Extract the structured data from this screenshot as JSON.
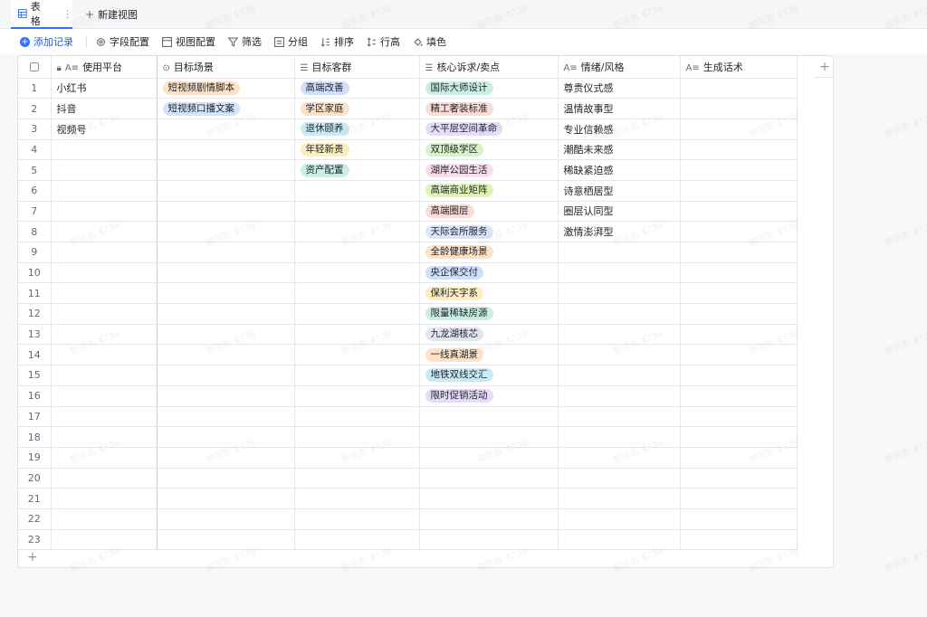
{
  "tabs": [
    {
      "label": "表格",
      "icon": "table-icon",
      "more": "⋮"
    },
    {
      "label": "新建视图",
      "icon": "plus-icon"
    }
  ],
  "toolbar": {
    "add_record": "添加记录",
    "field_config": "字段配置",
    "view_config": "视图配置",
    "filter": "筛选",
    "group": "分组",
    "sort": "排序",
    "row_height": "行高",
    "fill_color": "填色"
  },
  "columns": [
    {
      "label": "使用平台",
      "icon": "text-icon",
      "locked": true
    },
    {
      "label": "目标场景",
      "icon": "single-select-icon"
    },
    {
      "label": "目标客群",
      "icon": "multi-select-icon"
    },
    {
      "label": "核心诉求/卖点",
      "icon": "multi-select-icon"
    },
    {
      "label": "情绪/风格",
      "icon": "text-icon"
    },
    {
      "label": "生成话术",
      "icon": "text-icon"
    }
  ],
  "rows": [
    {
      "n": "1",
      "platform": "小红书",
      "scene": {
        "text": "短视频剧情脚本",
        "color": "#fde2c8"
      },
      "audience": {
        "text": "高端改善",
        "color": "#cfe0fc"
      },
      "selling": {
        "text": "国际大师设计",
        "color": "#c9efe4"
      },
      "mood": "尊贵仪式感",
      "script": ""
    },
    {
      "n": "2",
      "platform": "抖音",
      "scene": {
        "text": "短视频口播文案",
        "color": "#d5e4fc"
      },
      "audience": {
        "text": "学区家庭",
        "color": "#fde2c8"
      },
      "selling": {
        "text": "精工奢装标准",
        "color": "#fcdcd6"
      },
      "mood": "温情故事型",
      "script": ""
    },
    {
      "n": "3",
      "platform": "视频号",
      "scene": null,
      "audience": {
        "text": "退休颐养",
        "color": "#c8ecf5"
      },
      "selling": {
        "text": "大平层空间革命",
        "color": "#e6dcfa"
      },
      "mood": "专业信赖感",
      "script": ""
    },
    {
      "n": "4",
      "platform": "",
      "scene": null,
      "audience": {
        "text": "年轻新贵",
        "color": "#fbedbf"
      },
      "selling": {
        "text": "双顶级学区",
        "color": "#d6f2c9"
      },
      "mood": "潮酷未来感",
      "script": ""
    },
    {
      "n": "5",
      "platform": "",
      "scene": null,
      "audience": {
        "text": "资产配置",
        "color": "#c9efe4"
      },
      "selling": {
        "text": "湖岸公园生活",
        "color": "#fbdcec"
      },
      "mood": "稀缺紧迫感",
      "script": ""
    },
    {
      "n": "6",
      "platform": "",
      "scene": null,
      "audience": null,
      "selling": {
        "text": "高端商业矩阵",
        "color": "#def3b8"
      },
      "mood": "诗意栖居型",
      "script": ""
    },
    {
      "n": "7",
      "platform": "",
      "scene": null,
      "audience": null,
      "selling": {
        "text": "高端圈层",
        "color": "#fcdcd6"
      },
      "mood": "圈层认同型",
      "script": ""
    },
    {
      "n": "8",
      "platform": "",
      "scene": null,
      "audience": null,
      "selling": {
        "text": "天际会所服务",
        "color": "#dbe4fb"
      },
      "mood": "激情澎湃型",
      "script": ""
    },
    {
      "n": "9",
      "platform": "",
      "scene": null,
      "audience": null,
      "selling": {
        "text": "全龄健康场景",
        "color": "#fde2c8"
      },
      "mood": "",
      "script": ""
    },
    {
      "n": "10",
      "platform": "",
      "scene": null,
      "audience": null,
      "selling": {
        "text": "央企保交付",
        "color": "#cfe0fc"
      },
      "mood": "",
      "script": ""
    },
    {
      "n": "11",
      "platform": "",
      "scene": null,
      "audience": null,
      "selling": {
        "text": "保利天字系",
        "color": "#fbedbf"
      },
      "mood": "",
      "script": ""
    },
    {
      "n": "12",
      "platform": "",
      "scene": null,
      "audience": null,
      "selling": {
        "text": "限量稀缺房源",
        "color": "#c9efe4"
      },
      "mood": "",
      "script": ""
    },
    {
      "n": "13",
      "platform": "",
      "scene": null,
      "audience": null,
      "selling": {
        "text": "九龙湖核芯",
        "color": "#e1e6f0"
      },
      "mood": "",
      "script": ""
    },
    {
      "n": "14",
      "platform": "",
      "scene": null,
      "audience": null,
      "selling": {
        "text": "一线真湖景",
        "color": "#fde2c8"
      },
      "mood": "",
      "script": ""
    },
    {
      "n": "15",
      "platform": "",
      "scene": null,
      "audience": null,
      "selling": {
        "text": "地铁双线交汇",
        "color": "#c8ecf5"
      },
      "mood": "",
      "script": ""
    },
    {
      "n": "16",
      "platform": "",
      "scene": null,
      "audience": null,
      "selling": {
        "text": "限时促销活动",
        "color": "#e6dcfa"
      },
      "mood": "",
      "script": ""
    },
    {
      "n": "17",
      "platform": "",
      "scene": null,
      "audience": null,
      "selling": null,
      "mood": "",
      "script": ""
    },
    {
      "n": "18",
      "platform": "",
      "scene": null,
      "audience": null,
      "selling": null,
      "mood": "",
      "script": ""
    },
    {
      "n": "19",
      "platform": "",
      "scene": null,
      "audience": null,
      "selling": null,
      "mood": "",
      "script": ""
    },
    {
      "n": "20",
      "platform": "",
      "scene": null,
      "audience": null,
      "selling": null,
      "mood": "",
      "script": ""
    },
    {
      "n": "21",
      "platform": "",
      "scene": null,
      "audience": null,
      "selling": null,
      "mood": "",
      "script": ""
    },
    {
      "n": "22",
      "platform": "",
      "scene": null,
      "audience": null,
      "selling": null,
      "mood": "",
      "script": ""
    },
    {
      "n": "23",
      "platform": "",
      "scene": null,
      "audience": null,
      "selling": null,
      "mood": "",
      "script": ""
    }
  ],
  "add_column": "+",
  "add_row": "+",
  "watermark": "曾凤燕 4738"
}
